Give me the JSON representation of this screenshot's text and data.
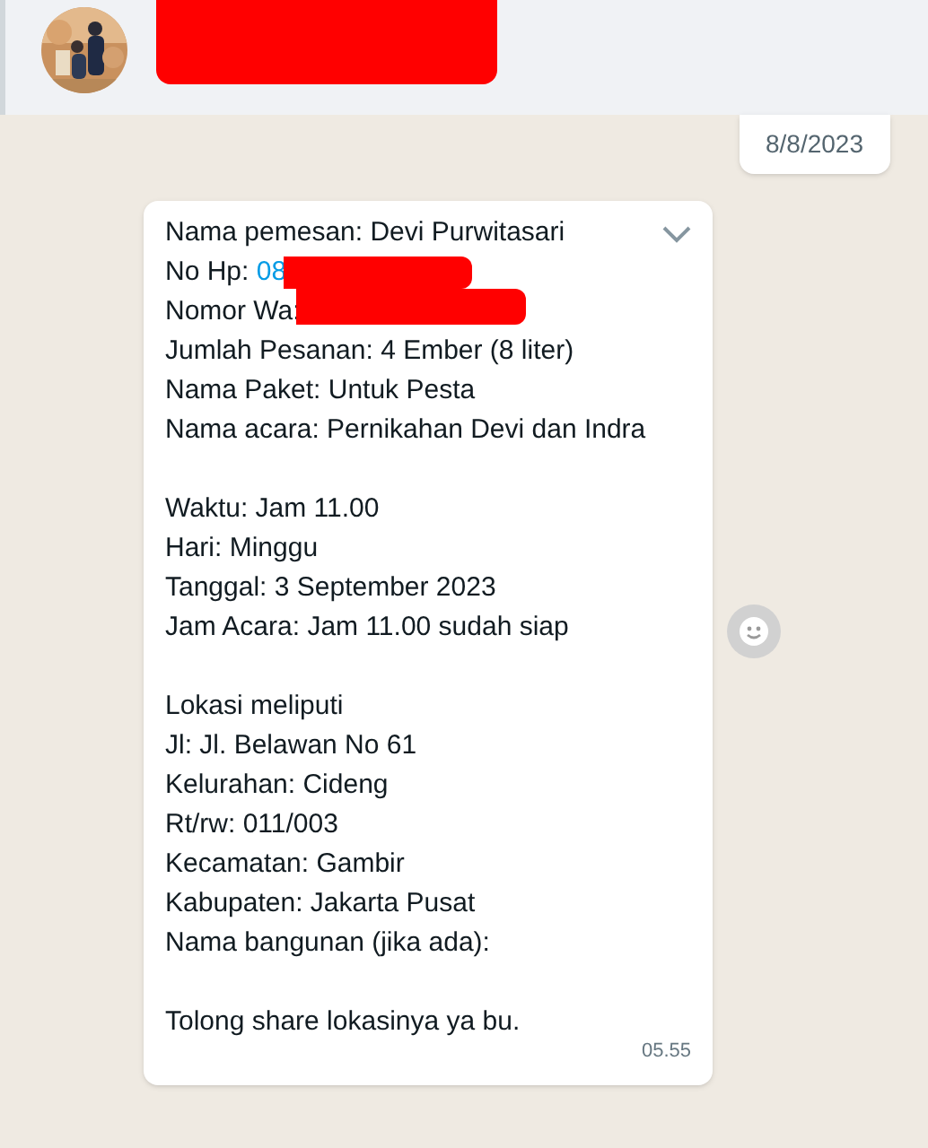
{
  "header": {
    "name_redacted": true
  },
  "date_chip": "8/8/2023",
  "message": {
    "paragraphs": [
      [
        {
          "text": "Nama pemesan: Devi Purwitasari"
        },
        {
          "text": "No Hp: ",
          "link": "08",
          "redacted": true
        },
        {
          "text": "Nomor Wa: ",
          "redacted": true
        },
        {
          "text": "Jumlah Pesanan: 4 Ember (8 liter)"
        },
        {
          "text": "Nama Paket: Untuk Pesta"
        },
        {
          "text": "Nama acara: Pernikahan Devi dan Indra"
        }
      ],
      [
        {
          "text": "Waktu: Jam 11.00"
        },
        {
          "text": "Hari: Minggu"
        },
        {
          "text": "Tanggal: 3 September 2023"
        },
        {
          "text": "Jam Acara: Jam 11.00 sudah siap"
        }
      ],
      [
        {
          "text": "Lokasi meliputi"
        },
        {
          "text": "Jl: Jl. Belawan No 61"
        },
        {
          "text": "Kelurahan: Cideng"
        },
        {
          "text": "Rt/rw: 011/003"
        },
        {
          "text": "Kecamatan: Gambir"
        },
        {
          "text": "Kabupaten: Jakarta Pusat"
        },
        {
          "text": "Nama bangunan (jika ada):"
        }
      ],
      [
        {
          "text": "Tolong share lokasinya ya bu."
        }
      ]
    ],
    "time": "05.55"
  }
}
